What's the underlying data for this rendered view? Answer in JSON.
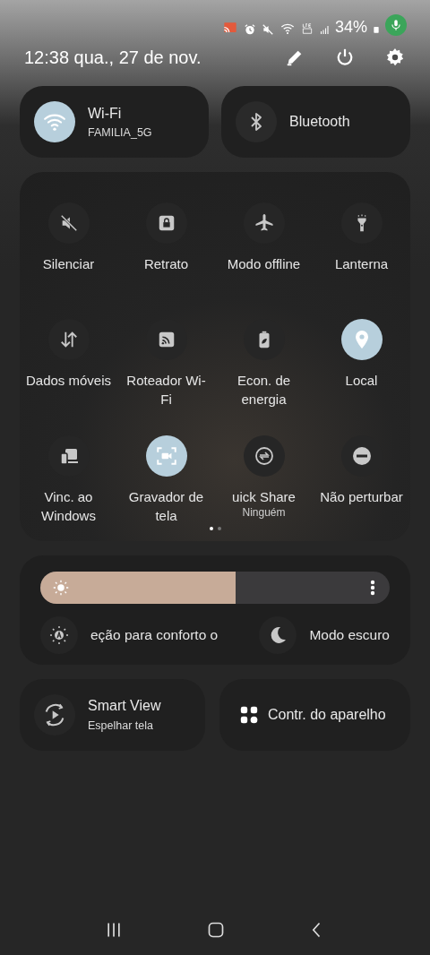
{
  "status_bar": {
    "battery": "34%"
  },
  "header": {
    "time": "12:38",
    "date": "qua., 27 de nov."
  },
  "big_tiles": [
    {
      "kind": "wifi",
      "title": "Wi-Fi",
      "subtitle": "FAMILIA_5G",
      "on": true
    },
    {
      "kind": "bluetooth",
      "title": "Bluetooth",
      "on": false
    }
  ],
  "tiles": [
    {
      "kind": "mute",
      "label": "Silenciar",
      "on": false
    },
    {
      "kind": "lock",
      "label": "Retrato",
      "on": false
    },
    {
      "kind": "airplane",
      "label": "Modo offline",
      "on": false
    },
    {
      "kind": "flashlight",
      "label": "Lanterna",
      "on": false
    },
    {
      "kind": "data",
      "label": "Dados móveis",
      "on": false
    },
    {
      "kind": "hotspot",
      "label": "Roteador Wi-Fi",
      "on": false
    },
    {
      "kind": "battery",
      "label": "Econ. de energia",
      "on": false
    },
    {
      "kind": "location",
      "label": "Local",
      "on": true
    },
    {
      "kind": "devices",
      "label": "Vinc. ao Windows",
      "on": false
    },
    {
      "kind": "record",
      "label": "Gravador de tela",
      "on": true
    },
    {
      "kind": "share",
      "label": "uick Share",
      "sublabel": "Ninguém",
      "on": false
    },
    {
      "kind": "dnd",
      "label": "Não perturbar",
      "on": false
    }
  ],
  "pages": [
    {
      "selected": true
    },
    {
      "selected": false
    }
  ],
  "brightness": {
    "level": 0.56
  },
  "display_options": [
    {
      "kind": "eye",
      "label": "eção para conforto o",
      "on": false
    },
    {
      "kind": "moon",
      "label": "Modo escuro",
      "on": false
    }
  ],
  "bottom_tiles": [
    {
      "kind": "smartview",
      "title": "Smart View",
      "subtitle": "Espelhar tela"
    },
    {
      "kind": "devicecontrol",
      "title": "Contr. do aparelho"
    }
  ]
}
